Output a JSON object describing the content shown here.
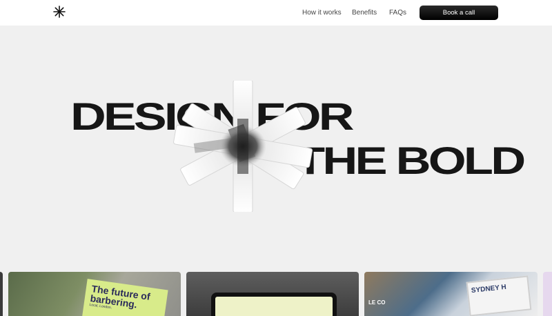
{
  "nav": {
    "links": [
      "How it works",
      "Benefits",
      "FAQs"
    ],
    "cta_label": "Book a call"
  },
  "hero": {
    "line1": "DESIGN FOR",
    "line2": "THE BOLD"
  },
  "gallery": {
    "card1": {
      "title": "The future of barbering.",
      "subtitle": "Local, London."
    },
    "card3": {
      "sign": "SYDNEY H",
      "small": "LE CO"
    }
  },
  "colors": {
    "accent": "#000000",
    "background": "#f0f0f0"
  }
}
